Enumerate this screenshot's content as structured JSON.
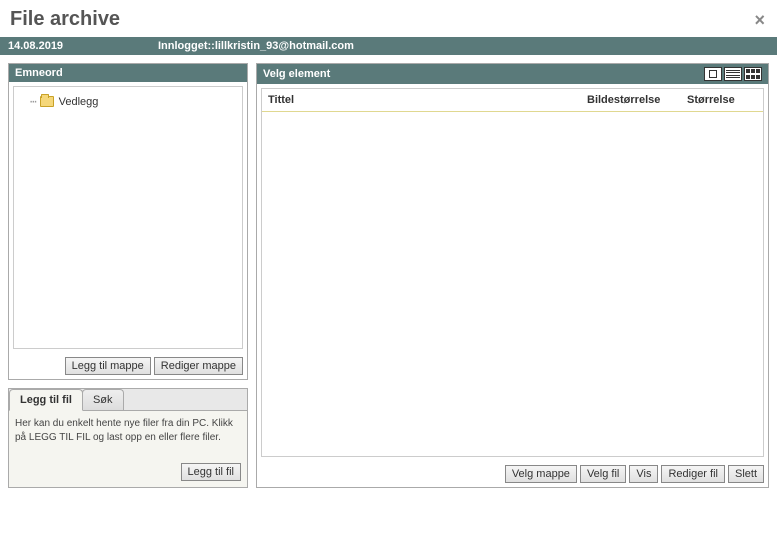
{
  "header": {
    "title": "File archive"
  },
  "status": {
    "date": "14.08.2019",
    "login": "Innlogget::lillkristin_93@hotmail.com"
  },
  "left": {
    "panel_title": "Emneord",
    "tree": {
      "root_label": "Vedlegg"
    },
    "buttons": {
      "add_folder": "Legg til mappe",
      "edit_folder": "Rediger mappe"
    }
  },
  "bottom": {
    "tabs": {
      "add_file": "Legg til fil",
      "search": "Søk"
    },
    "help_text": "Her kan du enkelt hente nye filer fra din PC. Klikk på LEGG TIL FIL og last opp en eller flere filer.",
    "add_file_btn": "Legg til fil"
  },
  "right": {
    "panel_title": "Velg element",
    "columns": {
      "title": "Tittel",
      "image_size": "Bildestørrelse",
      "size": "Størrelse"
    },
    "buttons": {
      "select_folder": "Velg mappe",
      "select_file": "Velg fil",
      "show": "Vis",
      "edit_file": "Rediger fil",
      "delete": "Slett"
    }
  }
}
